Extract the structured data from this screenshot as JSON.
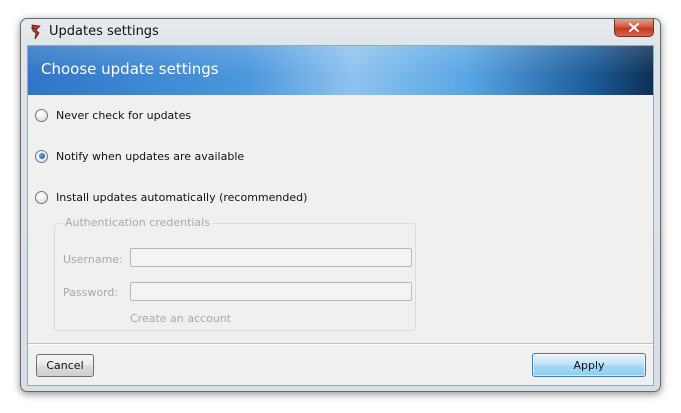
{
  "window": {
    "title": "Updates settings",
    "close_icon": "close-icon",
    "app_icon": "app-logo-icon"
  },
  "banner": {
    "title": "Choose update settings"
  },
  "update_options": [
    {
      "label": "Never check for updates",
      "selected": false
    },
    {
      "label": "Notify when updates are available",
      "selected": true
    },
    {
      "label": "Install updates automatically (recommended)",
      "selected": false
    }
  ],
  "credentials": {
    "legend": "Authentication credentials",
    "username_label": "Username:",
    "username_value": "",
    "password_label": "Password:",
    "password_value": "",
    "create_account_link": "Create an account",
    "enabled": false
  },
  "footer": {
    "cancel_label": "Cancel",
    "apply_label": "Apply"
  },
  "colors": {
    "banner_start": "#2f76c7",
    "banner_end": "#0d2f55",
    "apply_button": "#a7d8f7",
    "close_button": "#c2371d",
    "disabled_text": "#a8a8a8"
  }
}
